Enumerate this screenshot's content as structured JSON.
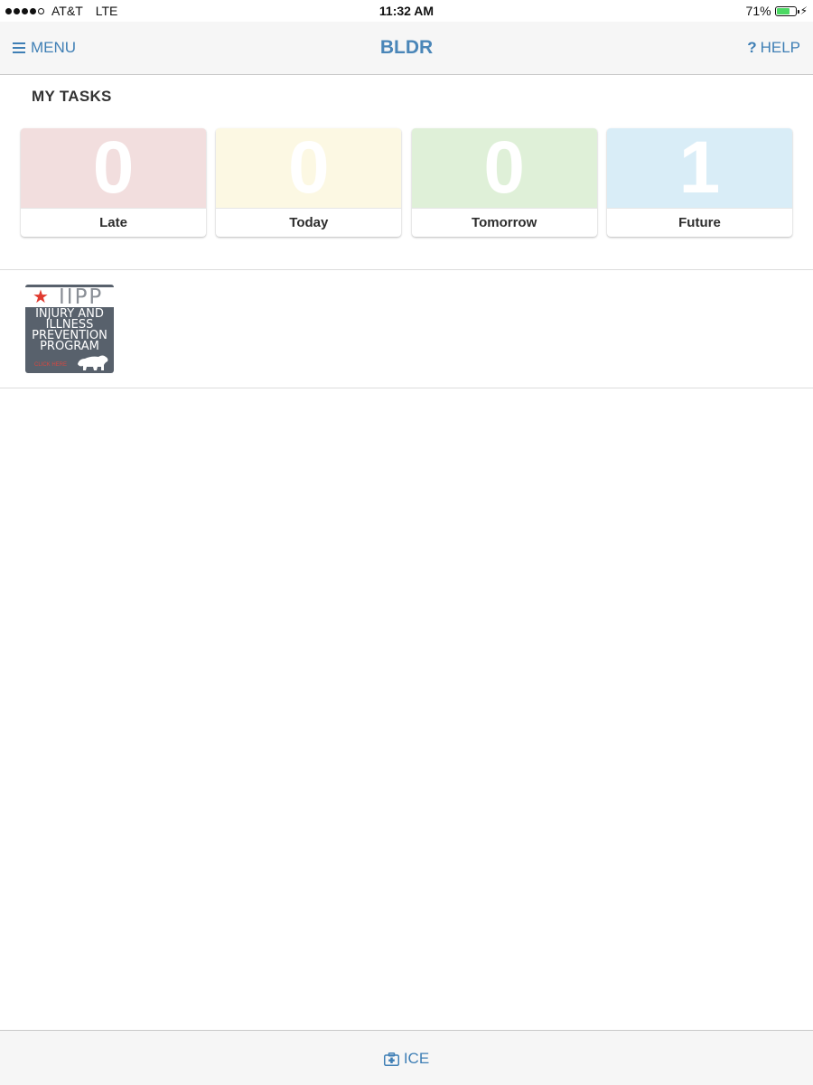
{
  "status_bar": {
    "signal_bars_filled": 4,
    "signal_bars_total": 5,
    "carrier": "AT&T",
    "network": "LTE",
    "time": "11:32 AM",
    "battery_percent": "71%",
    "battery_level": 0.71,
    "charging": true
  },
  "nav": {
    "menu_label": "MENU",
    "title": "BLDR",
    "help_label": "HELP",
    "help_glyph": "?"
  },
  "tasks": {
    "title": "MY TASKS",
    "tiles": [
      {
        "count": "0",
        "label": "Late",
        "color": "#f2dede"
      },
      {
        "count": "0",
        "label": "Today",
        "color": "#fcf8e3"
      },
      {
        "count": "0",
        "label": "Tomorrow",
        "color": "#dff0d8"
      },
      {
        "count": "1",
        "label": "Future",
        "color": "#d9edf7"
      }
    ]
  },
  "iipp_logo": {
    "letters": "IIPP",
    "lines": [
      "INJURY AND",
      "ILLNESS",
      "PREVENTION",
      "PROGRAM"
    ],
    "click_text": "CLICK HERE"
  },
  "bottom_bar": {
    "ice_label": "ICE"
  },
  "colors": {
    "accent": "#3f7fb5",
    "bar_background": "#f6f6f6",
    "logo_background": "#58616c",
    "star": "#e03a2f",
    "battery": "#4cd964"
  },
  "icons": {
    "menu": "hamburger-icon",
    "help": "question-icon",
    "ice": "medical-kit-icon",
    "star": "star-icon",
    "bear": "bear-icon"
  }
}
